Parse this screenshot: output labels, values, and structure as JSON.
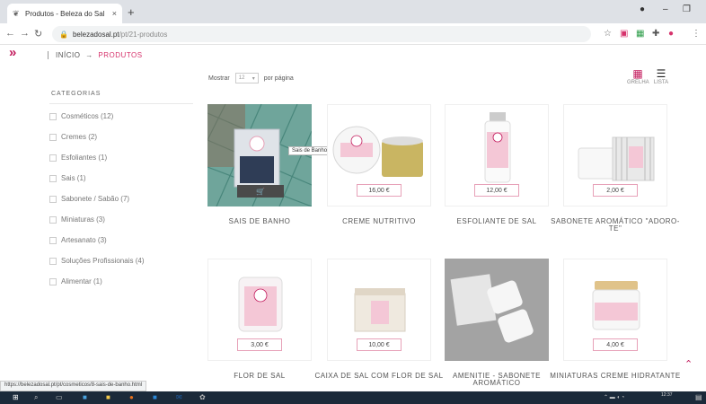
{
  "browser": {
    "tab_title": "Produtos - Beleza do Sal",
    "tab_close": "×",
    "new_tab": "+",
    "url_domain": "belezadosal.pt",
    "url_path": "/pt/21-produtos",
    "status_url": "https://belezadosal.pt/pt/cosmeticos/8-sais-de-banho.html"
  },
  "breadcrumb": {
    "home": "INÍCIO",
    "separator": "→",
    "current": "PRODUTOS"
  },
  "categories": {
    "heading": "CATEGORIAS",
    "items": [
      "Cosméticos (12)",
      "Cremes (2)",
      "Esfoliantes (1)",
      "Sais (1)",
      "Sabonete / Sabão (7)",
      "Miniaturas (3)",
      "Artesanato (3)",
      "Soluções Profissionais (4)",
      "Alimentar (1)"
    ]
  },
  "toolbar": {
    "show_label": "Mostrar",
    "per_page_value": "12",
    "per_page_label": "por página",
    "grid_label": "GRELHA",
    "list_label": "LISTA"
  },
  "products": [
    {
      "name": "SAIS DE BANHO",
      "tooltip": "Sais de Banho"
    },
    {
      "name": "CREME NUTRITIVO",
      "price": "16,00 €"
    },
    {
      "name": "ESFOLIANTE DE SAL",
      "price": "12,00 €"
    },
    {
      "name": "SABONETE AROMÁTICO \"ADORO-TE\"",
      "price": "2,00 €"
    },
    {
      "name": "FLOR DE SAL",
      "price": "3,00 €"
    },
    {
      "name": "CAIXA DE SAL COM FLOR DE SAL",
      "price": "10,00 €"
    },
    {
      "name": "AMENITIE - SABONETE AROMÁTICO"
    },
    {
      "name": "MINIATURAS CREME HIDRATANTE",
      "price": "4,00 €"
    }
  ],
  "taskbar": {
    "time": "12:37"
  },
  "colors": {
    "accent": "#d6336c",
    "grid_icon": "#c2185b",
    "taskbar": "#1b2a3a"
  }
}
